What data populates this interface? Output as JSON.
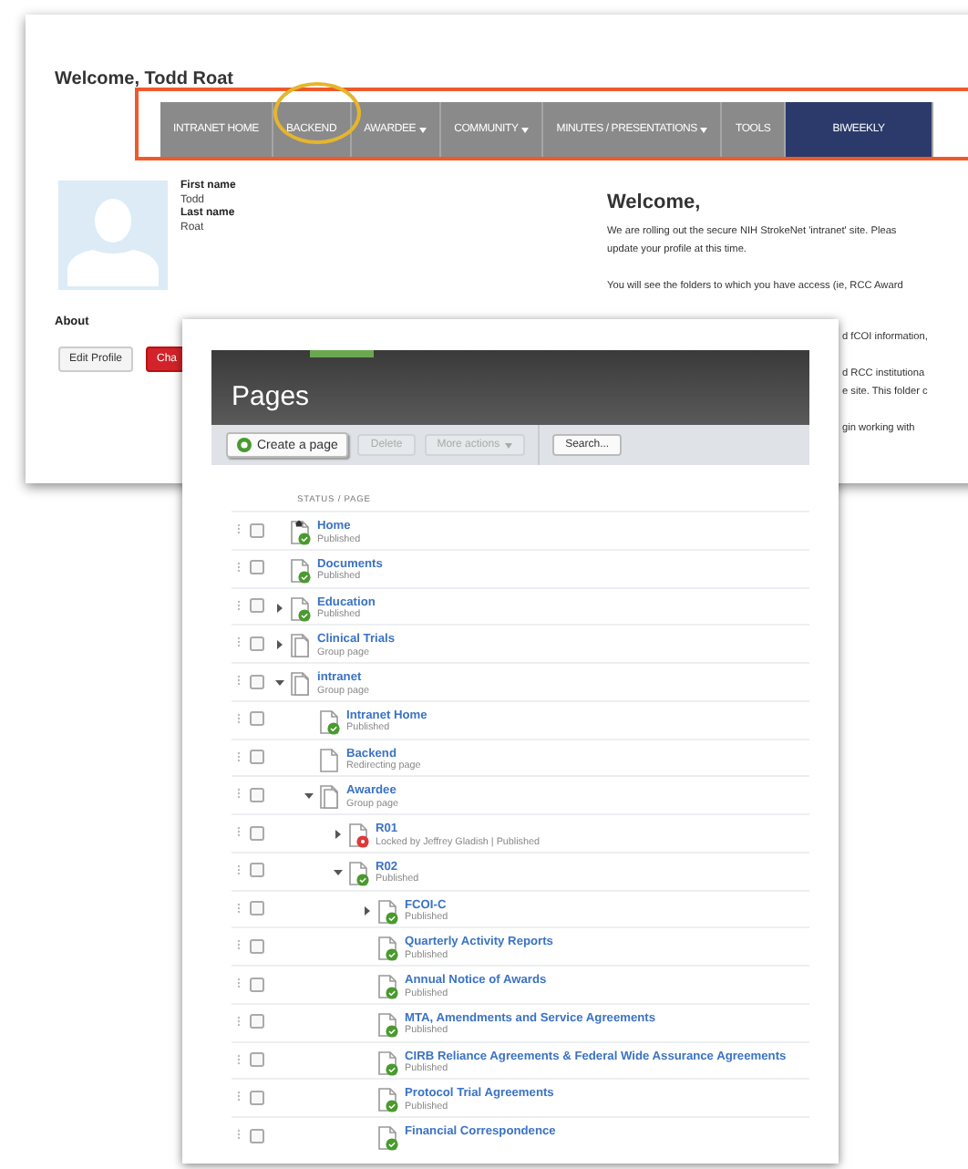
{
  "back_window": {
    "title": "Welcome, Todd Roat",
    "nav": [
      {
        "label": "INTRANET HOME",
        "dropdown": false,
        "selected": false
      },
      {
        "label": "BACKEND",
        "dropdown": false,
        "selected": false
      },
      {
        "label": "AWARDEE",
        "dropdown": true,
        "selected": false
      },
      {
        "label": "COMMUNITY",
        "dropdown": true,
        "selected": false
      },
      {
        "label": "MINUTES / PRESENTATIONS",
        "dropdown": true,
        "selected": false
      },
      {
        "label": "TOOLS",
        "dropdown": false,
        "selected": false
      },
      {
        "label": "BIWEEKLY",
        "dropdown": false,
        "selected": true
      }
    ],
    "profile": {
      "fields": [
        {
          "label": "First name",
          "value": "Todd"
        },
        {
          "label": "Last name",
          "value": "Roat"
        }
      ],
      "about_label": "About",
      "buttons": [
        {
          "label": "Edit Profile",
          "kind": "default"
        },
        {
          "label": "Cha",
          "kind": "danger"
        }
      ]
    },
    "welcome": {
      "heading": "Welcome,",
      "paragraphs": [
        [
          "We are rolling out the secure NIH StrokeNet 'intranet' site. Pleas",
          "update your profile at this time."
        ],
        [
          "You will see the folders to which you have access (ie, RCC Award"
        ]
      ],
      "partial_paragraphs": [
        [
          "d fCOI information,"
        ],
        [
          "d RCC institutiona",
          "e site. This folder c"
        ],
        [
          "gin working with"
        ]
      ]
    }
  },
  "pages_window": {
    "title": "Pages",
    "toolbar": [
      {
        "label": "Create a page",
        "kind": "create",
        "disabled": false
      },
      {
        "label": "Delete",
        "kind": "plain",
        "disabled": true
      },
      {
        "label": "More actions",
        "kind": "menu",
        "disabled": true
      },
      {
        "label": "Search...",
        "kind": "plain",
        "disabled": false
      }
    ],
    "column_header": "STATUS / PAGE",
    "rows": [
      {
        "title": "Home",
        "status": "Published",
        "kind": "home",
        "checked": false
      },
      {
        "title": "Documents",
        "status": "Published",
        "kind": "published",
        "checked": false
      },
      {
        "title": "Education",
        "status": "Published",
        "kind": "published",
        "checked": false,
        "expanded": false
      },
      {
        "title": "Clinical Trials",
        "status": "Group page",
        "kind": "group",
        "checked": false,
        "expanded": false
      },
      {
        "title": "intranet",
        "status": "Group page",
        "kind": "group",
        "checked": false,
        "expanded": true,
        "children": [
          {
            "title": "Intranet Home",
            "status": "Published",
            "kind": "published",
            "checked": false
          },
          {
            "title": "Backend",
            "status": "Redirecting page",
            "kind": "redirect",
            "checked": false
          },
          {
            "title": "Awardee",
            "status": "Group page",
            "kind": "group",
            "checked": false,
            "expanded": true,
            "children": [
              {
                "title": "R01",
                "status": "Locked by Jeffrey Gladish | Published",
                "kind": "locked",
                "checked": false,
                "expanded": false
              },
              {
                "title": "R02",
                "status": "Published",
                "kind": "published",
                "checked": false,
                "expanded": true,
                "children": [
                  {
                    "title": "FCOI-C",
                    "status": "Published",
                    "kind": "published",
                    "checked": false,
                    "expanded": false
                  },
                  {
                    "title": "Quarterly Activity Reports",
                    "status": "Published",
                    "kind": "published",
                    "checked": false
                  },
                  {
                    "title": "Annual Notice of Awards",
                    "status": "Published",
                    "kind": "published",
                    "checked": false
                  },
                  {
                    "title": "MTA, Amendments and Service Agreements",
                    "status": "Published",
                    "kind": "published",
                    "checked": false
                  },
                  {
                    "title": "CIRB Reliance Agreements & Federal Wide Assurance Agreements",
                    "status": "Published",
                    "kind": "published",
                    "checked": false
                  },
                  {
                    "title": "Protocol Trial Agreements",
                    "status": "Published",
                    "kind": "published",
                    "checked": false
                  },
                  {
                    "title": "Financial Correspondence",
                    "kind": "published",
                    "checked": false
                  }
                ]
              }
            ]
          }
        ]
      }
    ]
  }
}
